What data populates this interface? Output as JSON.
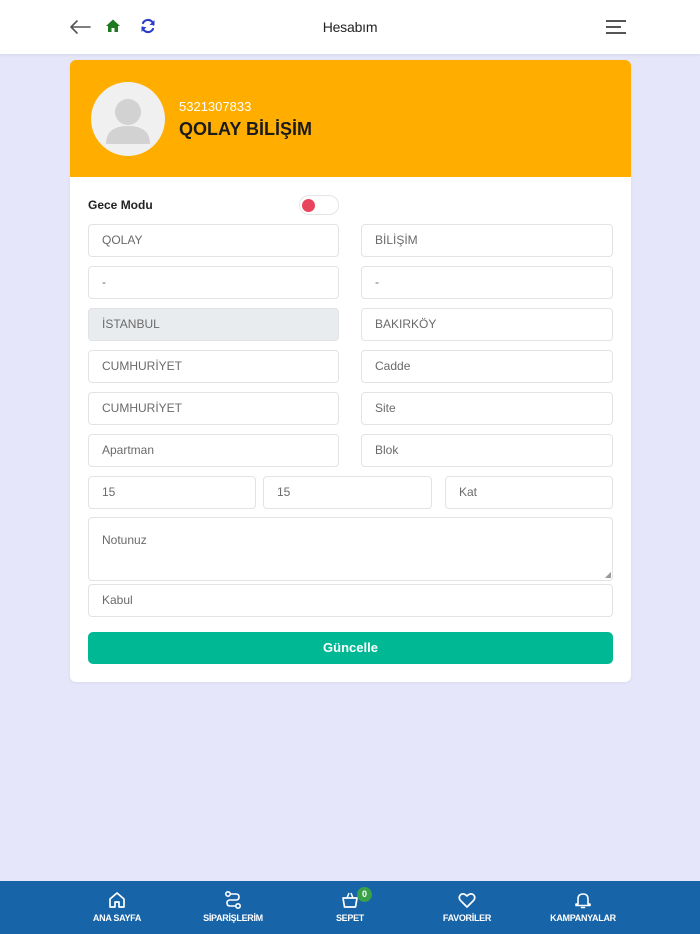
{
  "header": {
    "title": "Hesabım"
  },
  "profile": {
    "phone": "5321307833",
    "name": "QOLAY BİLİŞİM"
  },
  "settings": {
    "night_mode_label": "Gece Modu",
    "night_mode_on": false
  },
  "form": {
    "first_name": "QOLAY",
    "last_name": "BİLİŞİM",
    "field3": "-",
    "field4": "-",
    "city": "İSTANBUL",
    "district": "BAKIRKÖY",
    "neighborhood": "CUMHURİYET",
    "street_placeholder": "Cadde",
    "avenue": "CUMHURİYET",
    "site_placeholder": "Site",
    "apartment_placeholder": "Apartman",
    "block_placeholder": "Blok",
    "building_no": "15",
    "door_no": "15",
    "floor_placeholder": "Kat",
    "note_placeholder": "Notunuz",
    "acceptance_placeholder": "Kabul",
    "submit_label": "Güncelle"
  },
  "colors": {
    "header_bg": "#ffae00",
    "submit_bg": "#00b894",
    "nav_bg": "#1764a8",
    "toggle_knob": "#e8445e",
    "badge_bg": "#3aa04a"
  },
  "nav": {
    "home": "ANA SAYFA",
    "orders": "SİPARİŞLERİM",
    "cart": "SEPET",
    "cart_count": "0",
    "favorites": "FAVORİLER",
    "campaigns": "KAMPANYALAR"
  }
}
